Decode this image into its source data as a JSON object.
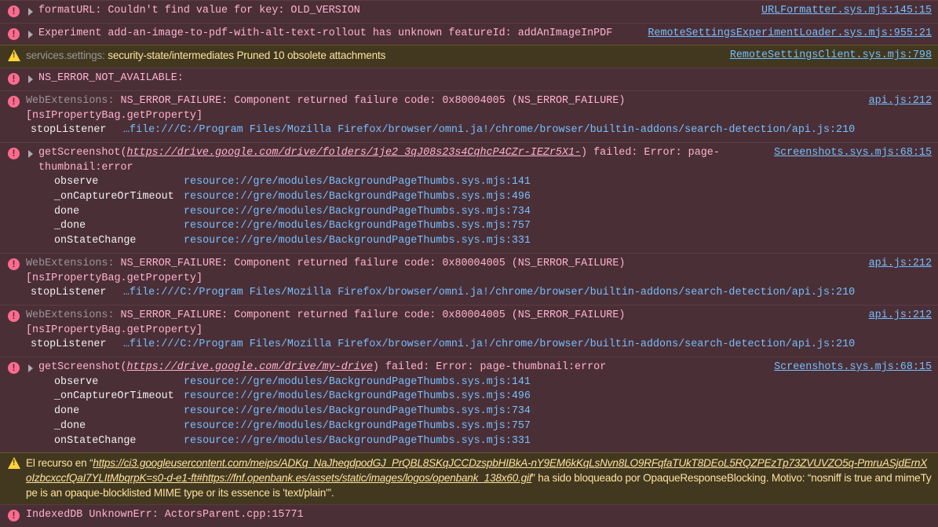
{
  "colors": {
    "error_bg": "#4b2f36",
    "error_text": "#ffb3d2",
    "warn_bg": "#42381f",
    "warn_text": "#fce2a1",
    "link": "#75bfff"
  },
  "messages": [
    {
      "level": "error",
      "twisty": true,
      "text": "formatURL: Couldn't find value for key:  OLD_VERSION",
      "source": "URLFormatter.sys.mjs:145:15"
    },
    {
      "level": "error",
      "twisty": true,
      "text": "Experiment add-an-image-to-pdf-with-alt-text-rollout has unknown featureId: addAnImageInPDF",
      "source": "RemoteSettingsExperimentLoader.sys.mjs:955:21"
    },
    {
      "level": "warn",
      "prefix": "services.settings:",
      "text": "security-state/intermediates Pruned 10 obsolete attachments",
      "source": "RemoteSettingsClient.sys.mjs:798",
      "mono": true
    },
    {
      "level": "error",
      "twisty": true,
      "text": "NS_ERROR_NOT_AVAILABLE:"
    },
    {
      "level": "error",
      "prefix": "WebExtensions:",
      "text": "NS_ERROR_FAILURE: Component returned failure code: 0x80004005 (NS_ERROR_FAILURE) [nsIPropertyBag.getProperty]",
      "source": "api.js:212",
      "stack_style": 1,
      "stack": [
        {
          "fn": "stopListener",
          "loc": "…file:///C:/Program Files/Mozilla Firefox/browser/omni.ja!/chrome/browser/builtin-addons/search-detection/api.js:210"
        }
      ]
    },
    {
      "level": "error",
      "twisty": true,
      "text_before": "getScreenshot(",
      "url": "https://drive.google.com/drive/folders/1je2_3qJ08s23s4CqhcP4CZr-IEZr5X1-",
      "text_after": ") failed: Error: page-thumbnail:error",
      "source": "Screenshots.sys.mjs:68:15",
      "stack_style": 2,
      "stack": [
        {
          "fn": "observe",
          "loc": "resource://gre/modules/BackgroundPageThumbs.sys.mjs:141"
        },
        {
          "fn": "_onCaptureOrTimeout",
          "loc": "resource://gre/modules/BackgroundPageThumbs.sys.mjs:496"
        },
        {
          "fn": "done",
          "loc": "resource://gre/modules/BackgroundPageThumbs.sys.mjs:734"
        },
        {
          "fn": "_done",
          "loc": "resource://gre/modules/BackgroundPageThumbs.sys.mjs:757"
        },
        {
          "fn": "onStateChange",
          "loc": "resource://gre/modules/BackgroundPageThumbs.sys.mjs:331"
        }
      ]
    },
    {
      "level": "error",
      "prefix": "WebExtensions:",
      "text": "NS_ERROR_FAILURE: Component returned failure code: 0x80004005 (NS_ERROR_FAILURE) [nsIPropertyBag.getProperty]",
      "source": "api.js:212",
      "stack_style": 1,
      "stack": [
        {
          "fn": "stopListener",
          "loc": "…file:///C:/Program Files/Mozilla Firefox/browser/omni.ja!/chrome/browser/builtin-addons/search-detection/api.js:210"
        }
      ]
    },
    {
      "level": "error",
      "prefix": "WebExtensions:",
      "text": "NS_ERROR_FAILURE: Component returned failure code: 0x80004005 (NS_ERROR_FAILURE) [nsIPropertyBag.getProperty]",
      "source": "api.js:212",
      "stack_style": 1,
      "stack": [
        {
          "fn": "stopListener",
          "loc": "…file:///C:/Program Files/Mozilla Firefox/browser/omni.ja!/chrome/browser/builtin-addons/search-detection/api.js:210"
        }
      ]
    },
    {
      "level": "error",
      "twisty": true,
      "text_before": "getScreenshot(",
      "url": "https://drive.google.com/drive/my-drive",
      "text_after": ") failed: Error: page-thumbnail:error",
      "source": "Screenshots.sys.mjs:68:15",
      "stack_style": 2,
      "stack": [
        {
          "fn": "observe",
          "loc": "resource://gre/modules/BackgroundPageThumbs.sys.mjs:141"
        },
        {
          "fn": "_onCaptureOrTimeout",
          "loc": "resource://gre/modules/BackgroundPageThumbs.sys.mjs:496"
        },
        {
          "fn": "done",
          "loc": "resource://gre/modules/BackgroundPageThumbs.sys.mjs:734"
        },
        {
          "fn": "_done",
          "loc": "resource://gre/modules/BackgroundPageThumbs.sys.mjs:757"
        },
        {
          "fn": "onStateChange",
          "loc": "resource://gre/modules/BackgroundPageThumbs.sys.mjs:331"
        }
      ]
    },
    {
      "level": "warn",
      "text_before": "El recurso en “",
      "url": "https://ci3.googleusercontent.com/meips/ADKq_NaJheqdpodGJ_PrQBL8SKqJCCDzspbHIBkA-nY9EM6kKqLsNvn8LO9RFqfaTUkT8DEoL5RQZPEzTp73ZVUVZO5q-PmruASjdErnXoIzbcxccfQaI7YLItMbqrpK=s0-d-e1-ft#https://fnf.openbank.es/assets/static/images/logos/openbank_138x60.gif",
      "text_after": "” ha sido bloqueado por OpaqueResponseBlocking. Motivo: “nosniff is true and mimeType is an opaque-blocklisted MIME type or its essence is 'text/plain'”."
    },
    {
      "level": "error",
      "text": "IndexedDB UnknownErr: ActorsParent.cpp:15771"
    }
  ]
}
